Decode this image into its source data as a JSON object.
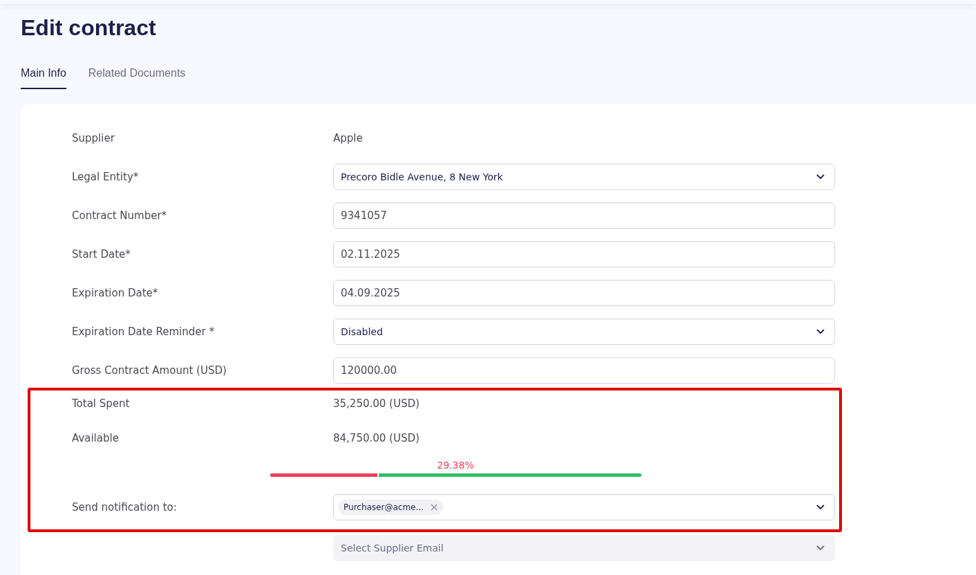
{
  "page": {
    "title": "Edit contract"
  },
  "tabs": [
    {
      "label": "Main Info",
      "selected": true
    },
    {
      "label": "Related Documents",
      "selected": false
    }
  ],
  "form": {
    "rows": [
      {
        "kind": "text",
        "label": "Supplier",
        "value": "Apple"
      },
      {
        "kind": "select",
        "label": "Legal Entity*",
        "value": "Precoro Bidle Avenue, 8 New York"
      },
      {
        "kind": "input",
        "label": "Contract Number*",
        "value": "9341057"
      },
      {
        "kind": "input",
        "label": "Start Date*",
        "value": "02.11.2025"
      },
      {
        "kind": "input",
        "label": "Expiration Date*",
        "value": "04.09.2025"
      },
      {
        "kind": "select",
        "label": "Expiration Date Reminder *",
        "value": "Disabled"
      },
      {
        "kind": "input",
        "label": "Gross Contract Amount (USD)",
        "value": "120000.00"
      }
    ]
  },
  "highlight_group": {
    "rows": [
      {
        "kind": "text",
        "label": "Total Spent",
        "value": "35,250.00 (USD)"
      },
      {
        "kind": "text",
        "label": "Available",
        "value": "84,750.00 (USD)"
      },
      {
        "kind": "progress",
        "percent": "29.38%",
        "level": 0.2938
      },
      {
        "kind": "tags",
        "label": "Send notification to:",
        "tags": [
          "Purchaser@acme..."
        ]
      }
    ]
  },
  "after_rows": [
    {
      "kind": "select",
      "placeholder": "Select Supplier Email",
      "disabled": true
    }
  ]
}
